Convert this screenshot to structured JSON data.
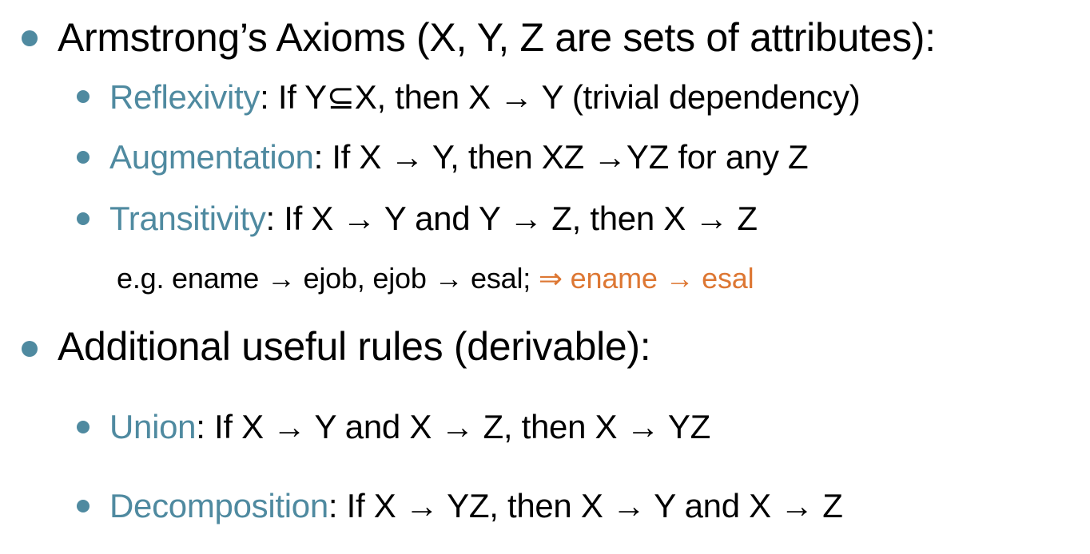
{
  "heading1": "Armstrong’s Axioms (X, Y, Z are sets of attributes):",
  "axioms": [
    {
      "term": "Reflexivity",
      "rest": ":  If  Y⊆X,  then X → Y (trivial dependency)"
    },
    {
      "term": "Augmentation",
      "rest": ":  If  X → Y,  then XZ →YZ for any Z"
    },
    {
      "term": "Transitivity",
      "rest": ":  If  X → Y and Y → Z, then X → Z"
    }
  ],
  "example": {
    "text": "e.g. ename → ejob, ejob → esal; ",
    "highlight": "⇒ ename  → esal"
  },
  "heading2": "Additional useful rules (derivable):",
  "rules": [
    {
      "term": "Union",
      "rest": ":  If X → Y and X → Z,  then X → YZ"
    },
    {
      "term": "Decomposition",
      "rest": ": If  X → YZ,  then X → Y and X → Z"
    }
  ],
  "colors": {
    "term": "#4f8aa0",
    "highlight": "#dd7733",
    "bullet": "#4f8aa0"
  }
}
